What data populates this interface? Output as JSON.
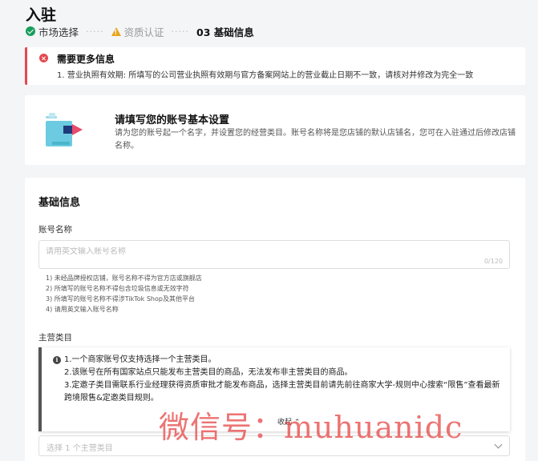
{
  "page": {
    "title": "入驻"
  },
  "steps": [
    {
      "label": "市场选择",
      "status": "done"
    },
    {
      "label": "资质认证",
      "status": "warning"
    },
    {
      "label": "03 基础信息",
      "status": "active"
    }
  ],
  "alert": {
    "title": "需要更多信息",
    "message": "1. 营业执照有效期: 所填写的公司营业执照有效期与官方备案网站上的营业截止日期不一致，请核对并修改为完全一致"
  },
  "intro": {
    "title": "请填写您的账号基本设置",
    "description": "请为您的账号起一个名字，并设置您的经营类目。账号名称将是您店铺的默认店铺名，您可在入驻通过后修改店铺名称。"
  },
  "form": {
    "section_title": "基础信息",
    "account_name": {
      "label": "账号名称",
      "placeholder": "请用英文输入账号名称",
      "value": "",
      "counter": "0/120",
      "rules": [
        "1) 未经品牌授权店铺，账号名称不得为官方店或旗舰店",
        "2) 所填写的账号名称不得包含垃圾信息或无效字符",
        "3) 所填写的账号名称不得涉TikTok Shop及其他平台",
        "4) 请用英文输入账号名称"
      ]
    },
    "main_category": {
      "label": "主营类目",
      "notes": [
        "1.一个商家账号仅支持选择一个主营类目。",
        "2.该账号在所有国家站点只能发布主营类目的商品，无法发布非主营类目的商品。",
        "3.定邀子类目需联系行业经理获得资质审批才能发布商品，选择主营类目前请先前往商家大学-规则中心搜索“限售”查看最新跨境限售&定邀类目规则。"
      ],
      "collapse_label": "收起",
      "select_placeholder": "选择 1 个主营类目"
    }
  },
  "watermark": "微信号：muhuanidc",
  "colors": {
    "success": "#1a9e5c",
    "warning": "#e8a317",
    "error": "#e5484d",
    "watermark": "#e84b4b"
  }
}
